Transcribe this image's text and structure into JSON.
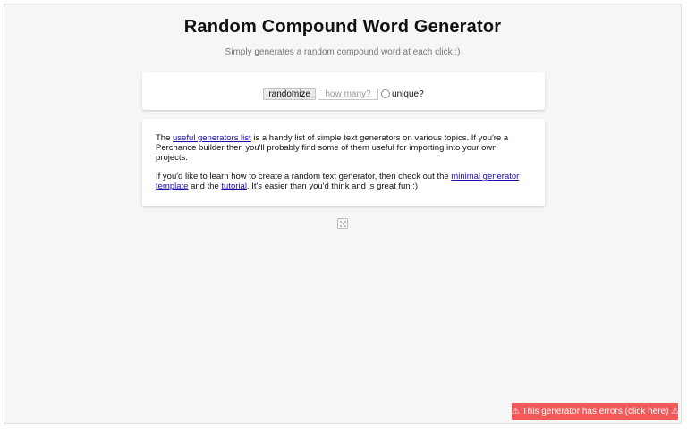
{
  "header": {
    "title": "Random Compound Word Generator",
    "subtitle": "Simply generates a random compound word at each click :)"
  },
  "controls": {
    "randomize_label": "randomize",
    "count_placeholder": "how many?",
    "count_value": "",
    "unique_label": "unique?",
    "unique_checked": false
  },
  "info": {
    "p1_pre": "The ",
    "p1_link": "useful generators list",
    "p1_post": " is a handy list of simple text generators on various topics. If you're a Perchance builder then you'll probably find some of them useful for importing into your own projects.",
    "p2_pre": "If you'd like to learn how to create a random text generator, then check out the ",
    "p2_link1": "minimal generator template",
    "p2_mid": " and the ",
    "p2_link2": "tutorial",
    "p2_post": ". It's easier than you'd think and is great fun :)"
  },
  "footer": {
    "dice_icon": "dice-icon",
    "error_text": "⚠ This generator has errors (click here) ⚠"
  },
  "colors": {
    "link": "#1a0dab",
    "error_bg": "#f25a5a"
  }
}
